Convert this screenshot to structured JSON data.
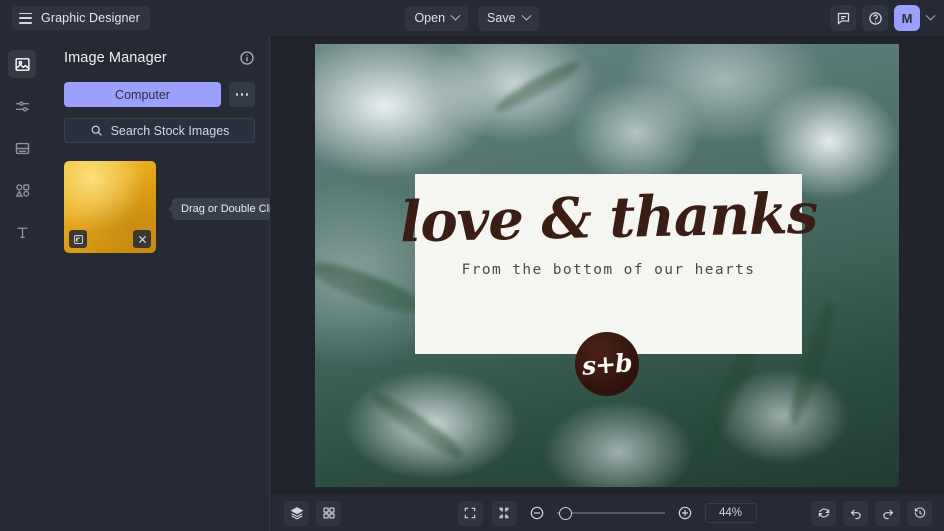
{
  "header": {
    "app_title": "Graphic Designer",
    "menu_icon": "hamburger-icon",
    "open_label": "Open",
    "save_label": "Save",
    "feedback_icon": "comment-icon",
    "help_icon": "help-circle-icon",
    "avatar_initial": "M",
    "avatar_color": "#9aa0fb"
  },
  "rail": {
    "items": [
      {
        "name": "image",
        "icon": "image-icon",
        "active": true
      },
      {
        "name": "adjustments",
        "icon": "sliders-icon",
        "active": false
      },
      {
        "name": "layout",
        "icon": "layout-icon",
        "active": false
      },
      {
        "name": "shapes",
        "icon": "shapes-icon",
        "active": false
      },
      {
        "name": "text",
        "icon": "text-icon",
        "active": false
      }
    ]
  },
  "panel": {
    "title": "Image Manager",
    "info_icon": "info-icon",
    "computer_label": "Computer",
    "more_label": "more-options",
    "search_placeholder": "Search Stock Images",
    "search_icon": "search-icon",
    "thumbnail": {
      "name": "gold-texture-thumbnail",
      "replace_icon": "replace-image-icon",
      "remove_icon": "close-icon"
    },
    "tooltip": "Drag or Double Click"
  },
  "canvas": {
    "card": {
      "headline": "love & thanks",
      "subline": "From the bottom of our hearts",
      "monogram": "s+b",
      "background_color": "#f5f5f1",
      "headline_color": "#3a1d14"
    }
  },
  "bottombar": {
    "layers_icon": "layers-icon",
    "grid_icon": "grid-icon",
    "fullscreen_icon": "fullscreen-icon",
    "fit_icon": "fit-to-screen-icon",
    "zoom_out_icon": "zoom-out-icon",
    "zoom_in_icon": "zoom-in-icon",
    "zoom_level": "44%",
    "reset_icon": "reset-icon",
    "undo_icon": "undo-icon",
    "redo_icon": "redo-icon",
    "history_icon": "history-icon"
  }
}
